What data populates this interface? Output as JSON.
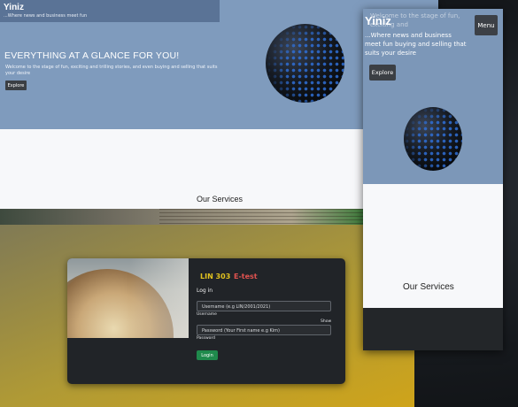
{
  "desktop": {
    "brand": "Yiniz",
    "tagline": "...Where news and business meet fun",
    "headline": "EVERYTHING AT A GLANCE FOR YOU!",
    "subtext": "Welcome to the stage of fun, exciting and trilling stories, and even buying and selling that suits your desire",
    "explore_label": "Explore",
    "services_heading": "Our Services"
  },
  "login": {
    "course_code": "LIN 303",
    "course_title": "E-test",
    "form_label": "Log in",
    "username_placeholder": "Username (e.g LIN/2001/2021)",
    "username_caption": "Username",
    "password_placeholder": "Password (Your First name e.g Kim)",
    "password_caption": "Password",
    "show_label": "Show",
    "login_label": "Login"
  },
  "mobile": {
    "brand": "Yiniz",
    "overlay_text": "Welcome to the stage of fun, exciting and",
    "tagline": "...Where news and business meet fun buying and selling that suits your desire",
    "menu_label": "Menu",
    "explore_label": "Explore",
    "services_heading": "Our Services"
  },
  "colors": {
    "hero_blue": "#7f9bbd",
    "course_code_yellow": "#e1c21f",
    "course_title_red": "#e0524f",
    "login_green": "#1f8a4c"
  }
}
